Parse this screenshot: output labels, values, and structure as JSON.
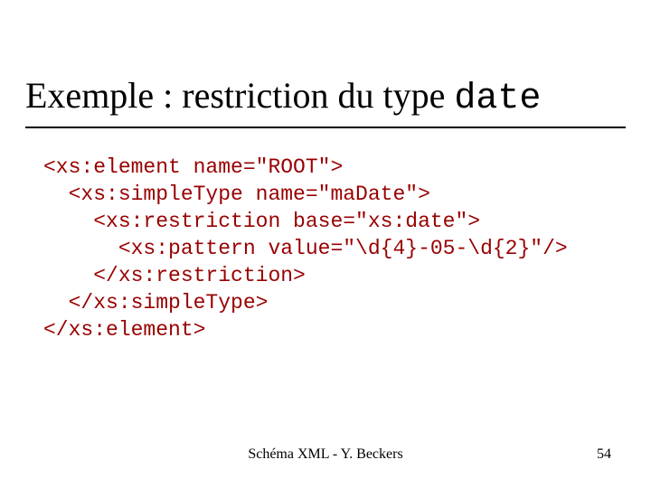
{
  "title": {
    "prefix": "Exemple : restriction du type ",
    "mono": "date"
  },
  "code": {
    "l1": "<xs:element name=\"ROOT\">",
    "l2": "  <xs:simpleType name=\"maDate\">",
    "l3": "    <xs:restriction base=\"xs:date\">",
    "l4": "      <xs:pattern value=\"\\d{4}-05-\\d{2}\"/>",
    "l5": "    </xs:restriction>",
    "l6": "  </xs:simpleType>",
    "l7": "</xs:element>"
  },
  "footer": {
    "center": "Schéma XML - Y. Beckers",
    "page": "54"
  }
}
